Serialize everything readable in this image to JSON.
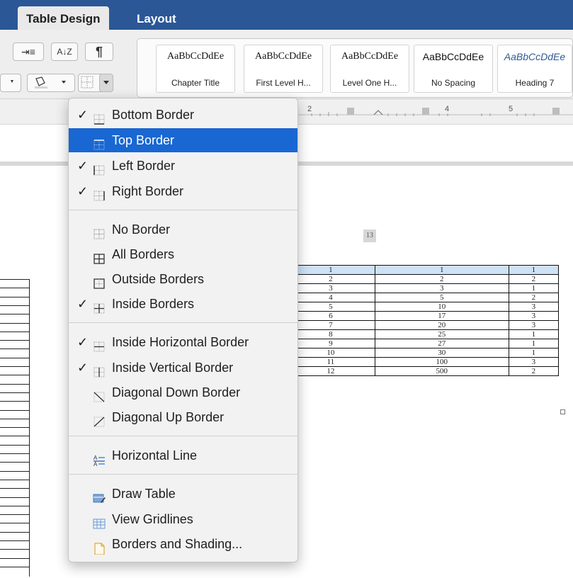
{
  "tabs": [
    {
      "label": "Table Design",
      "active": true
    },
    {
      "label": "Layout",
      "active": false
    }
  ],
  "ribbon": {
    "buttons": [
      "⇥≡",
      "A↓Z",
      "¶"
    ],
    "style_gallery": [
      {
        "preview": "AaBbCcDdEe",
        "name": "Chapter Title"
      },
      {
        "preview": "AaBbCcDdEe",
        "name": "First Level H..."
      },
      {
        "preview": "AaBbCcDdEe",
        "name": "Level One H..."
      },
      {
        "preview": "AaBbCcDdEe",
        "name": "No Spacing"
      },
      {
        "preview": "AaBbCcDdEe",
        "name": "Heading 7"
      }
    ]
  },
  "ruler": {
    "marks": [
      "2",
      "4",
      "5"
    ]
  },
  "document": {
    "page_number": "13",
    "table_rows": [
      [
        "1",
        "1",
        "1"
      ],
      [
        "2",
        "2",
        "2"
      ],
      [
        "3",
        "3",
        "1"
      ],
      [
        "4",
        "5",
        "2"
      ],
      [
        "5",
        "10",
        "3"
      ],
      [
        "6",
        "17",
        "3"
      ],
      [
        "7",
        "20",
        "3"
      ],
      [
        "8",
        "25",
        "1"
      ],
      [
        "9",
        "27",
        "1"
      ],
      [
        "10",
        "30",
        "1"
      ],
      [
        "11",
        "100",
        "3"
      ],
      [
        "12",
        "500",
        "2"
      ]
    ]
  },
  "menu": {
    "check_symbol": "✓",
    "highlight_color": "#1967d2",
    "items": [
      {
        "label": "Bottom Border",
        "checked": true,
        "icon": "bottom-border-icon"
      },
      {
        "label": "Top Border",
        "checked": false,
        "icon": "top-border-icon",
        "highlighted": true
      },
      {
        "label": "Left Border",
        "checked": true,
        "icon": "left-border-icon"
      },
      {
        "label": "Right Border",
        "checked": true,
        "icon": "right-border-icon"
      },
      {
        "label": "No Border",
        "checked": false,
        "icon": "no-border-icon"
      },
      {
        "label": "All Borders",
        "checked": false,
        "icon": "all-borders-icon"
      },
      {
        "label": "Outside Borders",
        "checked": false,
        "icon": "outside-borders-icon"
      },
      {
        "label": "Inside Borders",
        "checked": true,
        "icon": "inside-borders-icon"
      },
      {
        "label": "Inside Horizontal Border",
        "checked": true,
        "icon": "inside-horizontal-border-icon"
      },
      {
        "label": "Inside Vertical Border",
        "checked": true,
        "icon": "inside-vertical-border-icon"
      },
      {
        "label": "Diagonal Down Border",
        "checked": false,
        "icon": "diagonal-down-border-icon"
      },
      {
        "label": "Diagonal Up Border",
        "checked": false,
        "icon": "diagonal-up-border-icon"
      },
      {
        "label": "Horizontal Line",
        "checked": false,
        "icon": "horizontal-line-icon"
      },
      {
        "label": "Draw Table",
        "checked": false,
        "icon": "draw-table-icon"
      },
      {
        "label": "View Gridlines",
        "checked": false,
        "icon": "view-gridlines-icon"
      },
      {
        "label": "Borders and Shading...",
        "checked": false,
        "icon": "borders-and-shading-icon"
      }
    ]
  }
}
